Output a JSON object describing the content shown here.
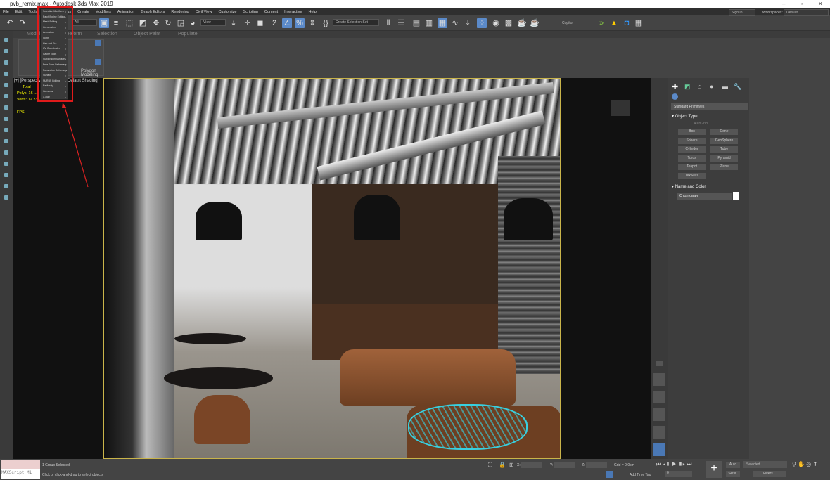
{
  "title": "pvb_remix.max - Autodesk 3ds Max 2019",
  "menubar": [
    "File",
    "Edit",
    "Tools",
    "Group",
    "Views",
    "Create",
    "Modifiers",
    "Animation",
    "Graph Editors",
    "Rendering",
    "Civil View",
    "Customize",
    "Scripting",
    "Content",
    "Interactive",
    "Help"
  ],
  "modifiers_menu": [
    "Selection Modifiers",
    "Patch/Spline Editing",
    "Mesh Editing",
    "Conversion",
    "Animation",
    "Cloth",
    "Hair and Fur",
    "UV Coordinates",
    "Cache Tools",
    "Subdivision Surfaces",
    "Free Form Deformers",
    "Parametric Deformers",
    "Surface",
    "NURBS Editing",
    "Radiosity",
    "Cameras",
    "X-Ray"
  ],
  "toolbar": {
    "filter": "All",
    "ref_coord": "View",
    "selection_set": "Create Selection Set",
    "copitor": "Copitor",
    "sign_in": "Sign In",
    "workspaces_label": "Workspaces:",
    "workspace": "Default"
  },
  "ribbon_tabs": [
    "Modeling",
    "Freeform",
    "Selection",
    "Object Paint",
    "Populate"
  ],
  "ribbon_panel_label": "Polygon Modeling",
  "viewport": {
    "label": "[+] [Perspective] [Standard] [Default Shading]",
    "stats": {
      "total": "Total",
      "polys_label": "Polys:",
      "polys": "16 ...",
      "verts_label": "Verts:",
      "verts": "12 236 946",
      "fps_label": "FPS:"
    }
  },
  "command_panel": {
    "category": "Standard Primitives",
    "object_type": "Object Type",
    "autogrid": "AutoGrid",
    "buttons": [
      "Box",
      "Cone",
      "Sphere",
      "GeoSphere",
      "Cylinder",
      "Tube",
      "Torus",
      "Pyramid",
      "Teapot",
      "Plane",
      "TextPlus"
    ],
    "name_and_color": "Name and Color",
    "name": "Стол овал",
    "color": "#ffffff"
  },
  "status": {
    "maxscript": "MAXScript Mi",
    "selected": "1 Group Selected",
    "prompt": "Click or click-and-drag to select objects",
    "x_label": "X:",
    "y_label": "Y:",
    "z_label": "Z:",
    "grid": "Grid = 0,0cm",
    "add_time_tag": "Add Time Tag",
    "auto": "Auto",
    "set_key": "Set K.",
    "selected_dd": "Selected",
    "filters": "Filters...",
    "frame": "0"
  },
  "colors": {
    "accent": "#5b8ac9",
    "highlight": "#e01b1b",
    "selection": "#38d0e0"
  }
}
